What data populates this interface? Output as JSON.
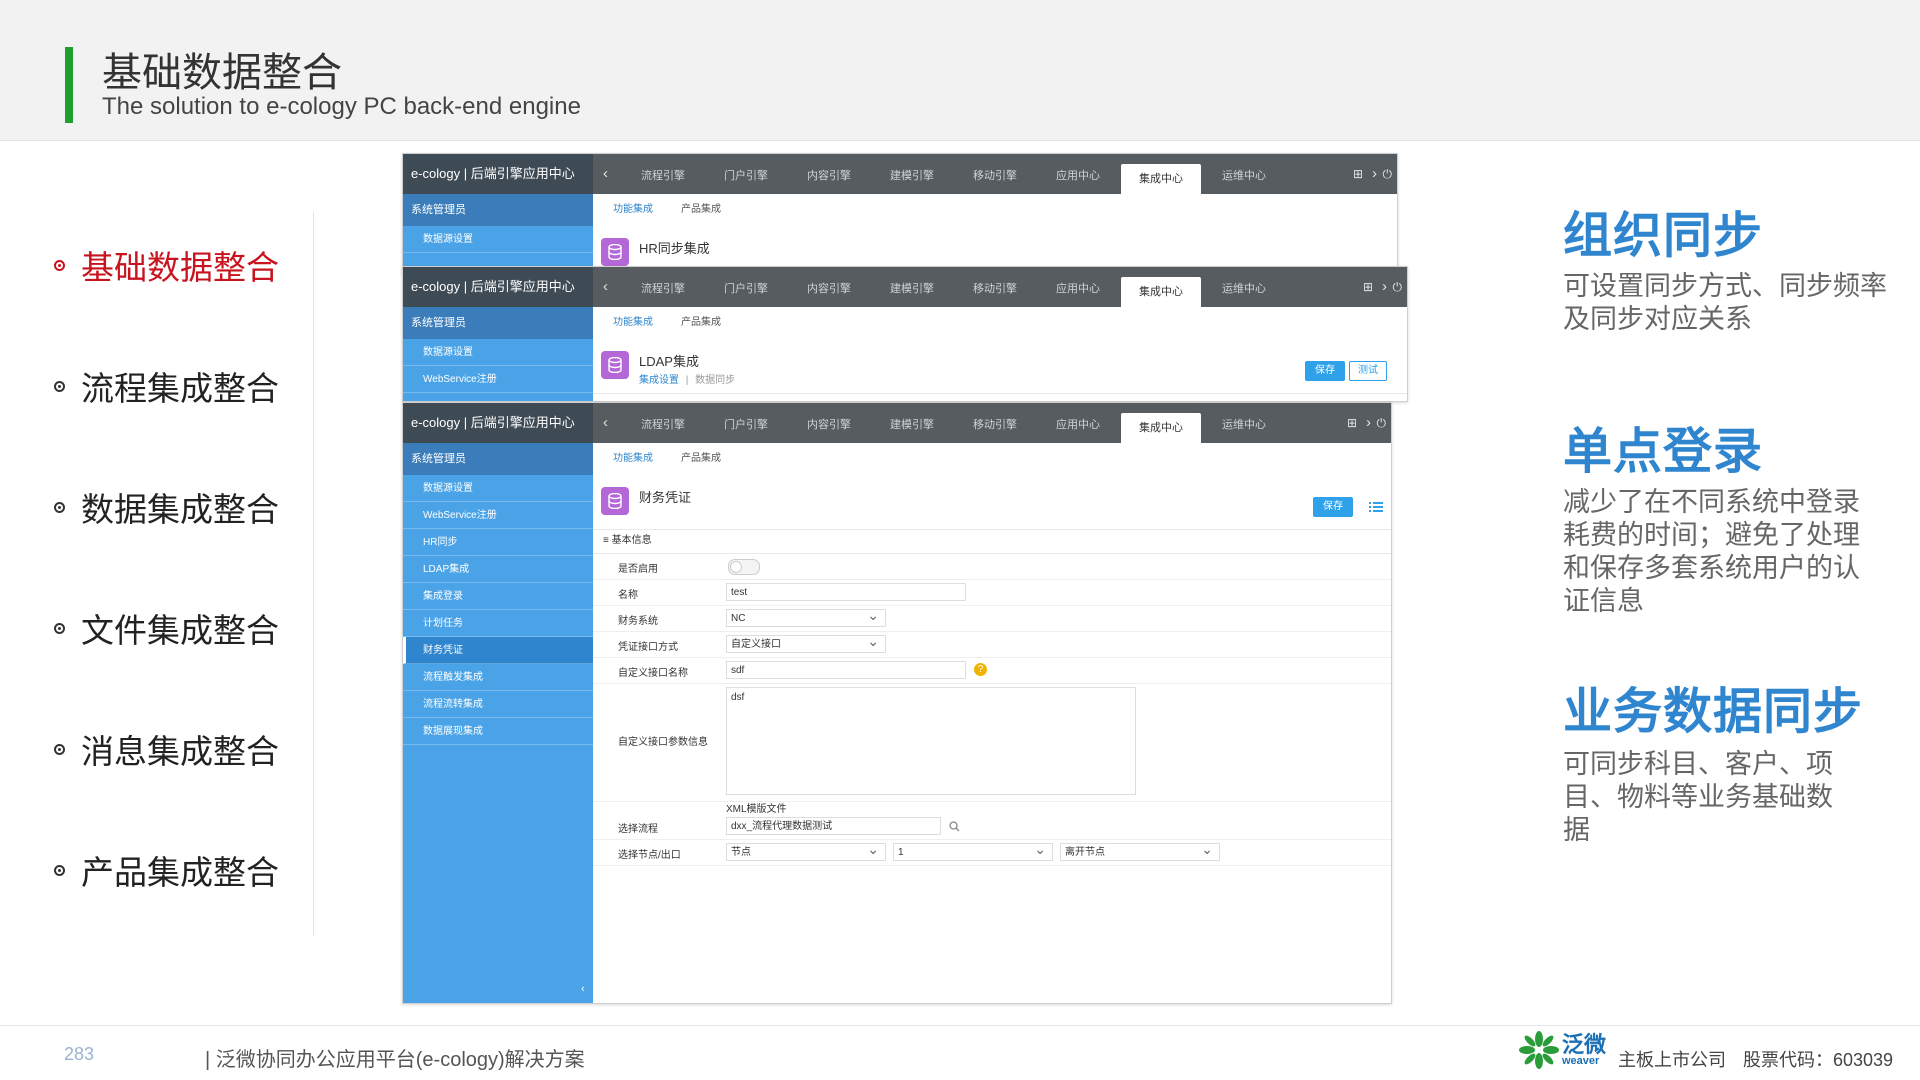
{
  "header": {
    "title": "基础数据整合",
    "subtitle": "The solution to e-cology PC back-end engine"
  },
  "menu": [
    {
      "label": "基础数据整合",
      "active": true
    },
    {
      "label": "流程集成整合",
      "active": false
    },
    {
      "label": "数据集成整合",
      "active": false
    },
    {
      "label": "文件集成整合",
      "active": false
    },
    {
      "label": "消息集成整合",
      "active": false
    },
    {
      "label": "产品集成整合",
      "active": false
    }
  ],
  "app": {
    "brand": "e-cology | 后端引擎应用中心",
    "back_glyph": "‹",
    "next_glyph": "›",
    "nav_tabs": [
      "流程引擎",
      "门户引擎",
      "内容引擎",
      "建模引擎",
      "移动引擎",
      "应用中心",
      "集成中心",
      "运维中心"
    ],
    "sidebar_head": "系统管理员",
    "subtabs": [
      "功能集成",
      "产品集成"
    ],
    "save_label": "保存",
    "test_label": "测试"
  },
  "win1": {
    "sidebar_items": [
      "数据源设置"
    ],
    "module_title": "HR同步集成"
  },
  "win2": {
    "sidebar_items": [
      "数据源设置",
      "WebService注册"
    ],
    "module_title": "LDAP集成",
    "links": [
      "集成设置",
      "数据同步"
    ]
  },
  "win3": {
    "sidebar_items": [
      "数据源设置",
      "WebService注册",
      "HR同步",
      "LDAP集成",
      "集成登录",
      "计划任务",
      "财务凭证",
      "流程触发集成",
      "流程流转集成",
      "数据展现集成"
    ],
    "active_sidebar": "财务凭证",
    "module_title": "财务凭证",
    "section": "基本信息",
    "form": {
      "enabled_label": "是否启用",
      "name_label": "名称",
      "name_value": "test",
      "system_label": "财务系统",
      "system_value": "NC",
      "method_label": "凭证接口方式",
      "method_value": "自定义接口",
      "iface_label": "自定义接口名称",
      "iface_value": "sdf",
      "params_label": "自定义接口参数信息",
      "params_value": "dsf",
      "xml_note": "XML模版文件",
      "flow_label": "选择流程",
      "flow_value": "dxx_流程代理数据测试",
      "node_label": "选择节点/出口",
      "node_value": "节点",
      "node_num": "1",
      "node_exit": "离开节点"
    }
  },
  "features": [
    {
      "title": "组织同步",
      "desc": "可设置同步方式、同步频率\n及同步对应关系"
    },
    {
      "title": "单点登录",
      "desc": "减少了在不同系统中登录\n耗费的时间；避免了处理\n和保存多套系统用户的认\n证信息"
    },
    {
      "title": "业务数据同步",
      "desc": "可同步科目、客户、项\n目、物料等业务基础数\n据"
    }
  ],
  "footer": {
    "page": "283",
    "text": "| 泛微协同办公应用平台(e-cology)解决方案",
    "logo_cn": "泛微",
    "logo_en": "weaver",
    "company": "主板上市公司",
    "code": "股票代码：603039"
  },
  "colors": {
    "accent_green": "#1e9e2e",
    "active_red": "#c8141e",
    "feature_blue": "#2f86cf",
    "sidebar_blue": "#4aa3e6",
    "topbar_gray": "#565c60"
  }
}
